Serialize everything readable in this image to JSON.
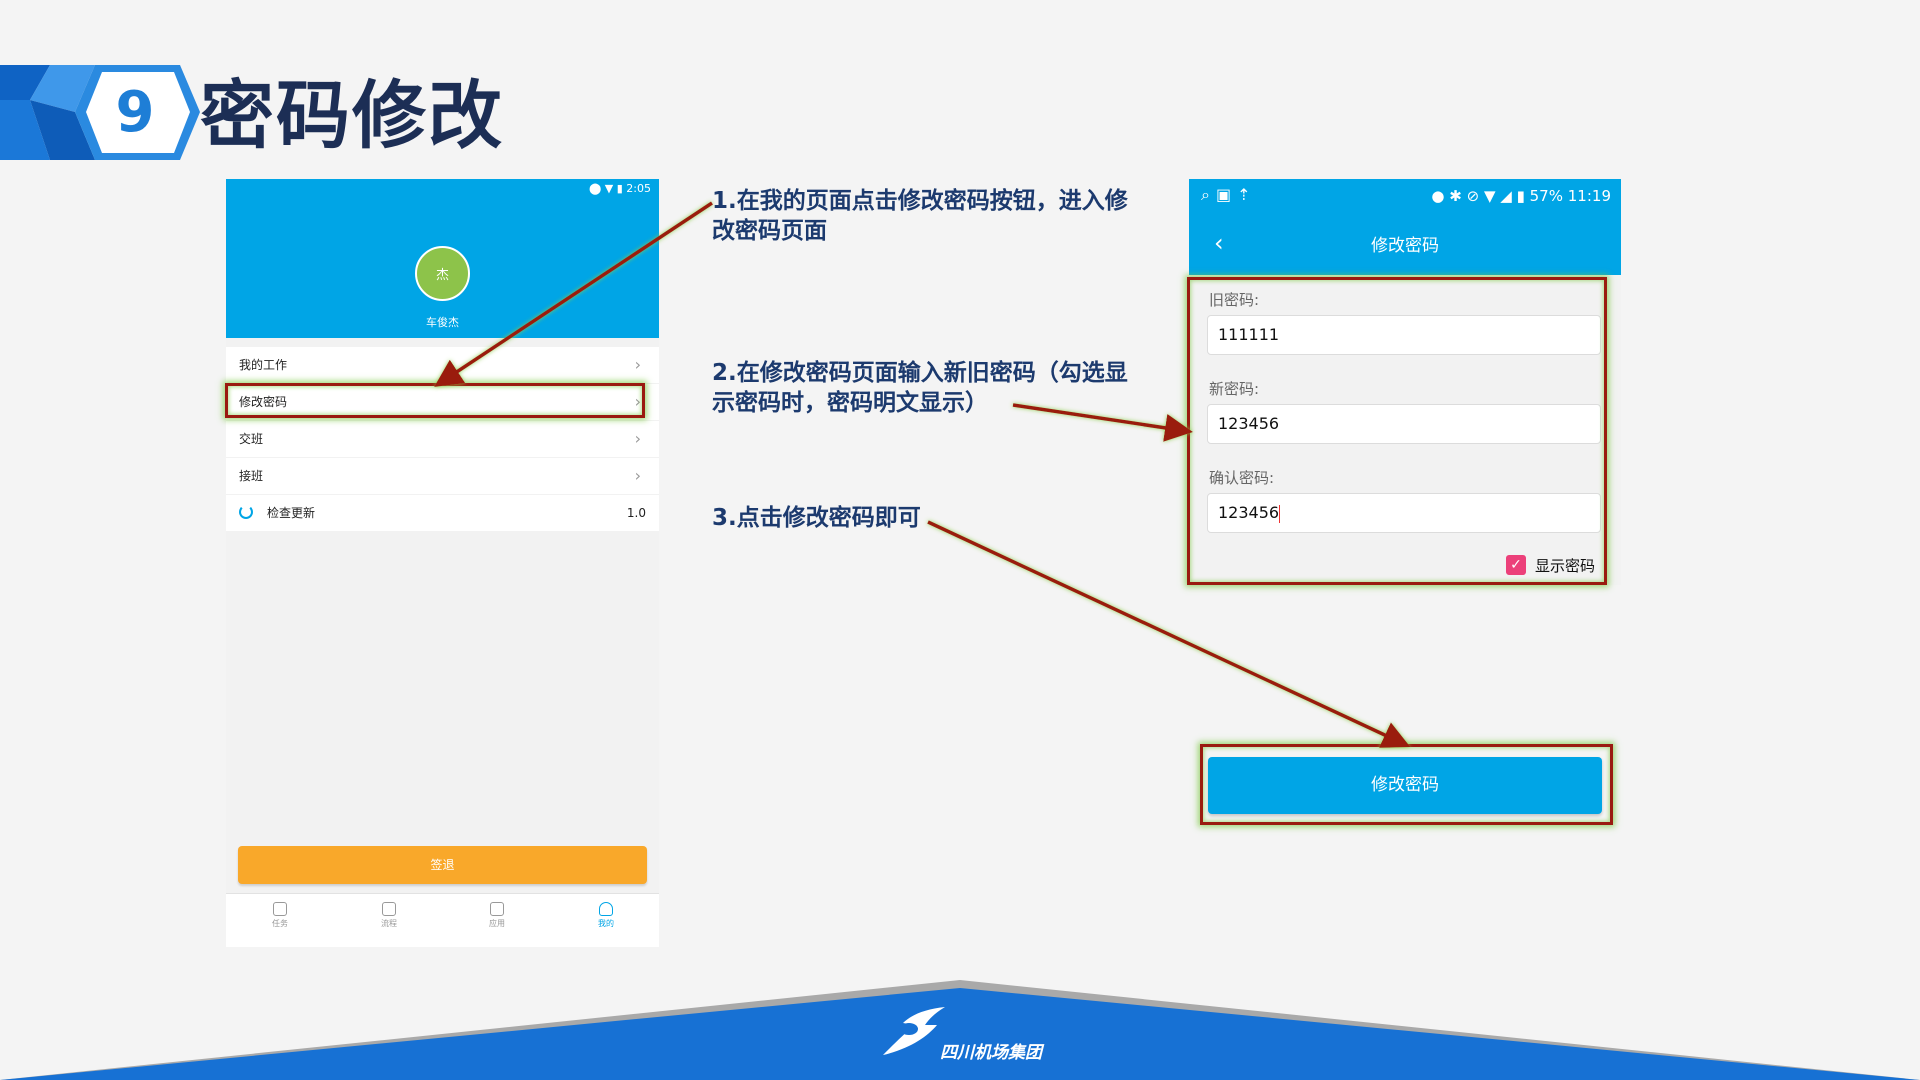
{
  "slide": {
    "number": "9",
    "title": "密码修改"
  },
  "steps": [
    {
      "text": "1.在我的页面点击修改密码按钮，进入修改密码页面"
    },
    {
      "text": "2.在修改密码页面输入新旧密码（勾选显示密码时，密码明文显示）"
    },
    {
      "text": "3.点击修改密码即可"
    }
  ],
  "phone1": {
    "status_time": "2:05",
    "avatar_text": "杰",
    "user_name": "车俊杰",
    "menu": [
      {
        "label": "我的工作"
      },
      {
        "label": "修改密码"
      },
      {
        "label": "交班"
      },
      {
        "label": "接班"
      }
    ],
    "update": {
      "label": "检查更新",
      "version": "1.0"
    },
    "signout_label": "签退",
    "tabs": [
      {
        "label": "任务",
        "icon": "clipboard-icon"
      },
      {
        "label": "流程",
        "icon": "document-icon"
      },
      {
        "label": "应用",
        "icon": "apps-grid-icon"
      },
      {
        "label": "我的",
        "icon": "person-icon"
      }
    ]
  },
  "phone2": {
    "status_battery": "57%",
    "status_time": "11:19",
    "header_title": "修改密码",
    "old_label": "旧密码:",
    "old_value": "111111",
    "new_label": "新密码:",
    "new_value": "123456",
    "confirm_label": "确认密码:",
    "confirm_value": "123456",
    "show_password_label": "显示密码",
    "show_password_checked": true,
    "submit_label": "修改密码"
  },
  "footer": {
    "brand": "四川机场集团"
  },
  "colors": {
    "title": "#1c2e55",
    "banner_blue": "#1e7ed6",
    "app_blue": "#00a5e6",
    "signout_orange": "#f9a82a",
    "highlight_red": "#9a1a10",
    "checkbox_pink": "#ec407a"
  }
}
